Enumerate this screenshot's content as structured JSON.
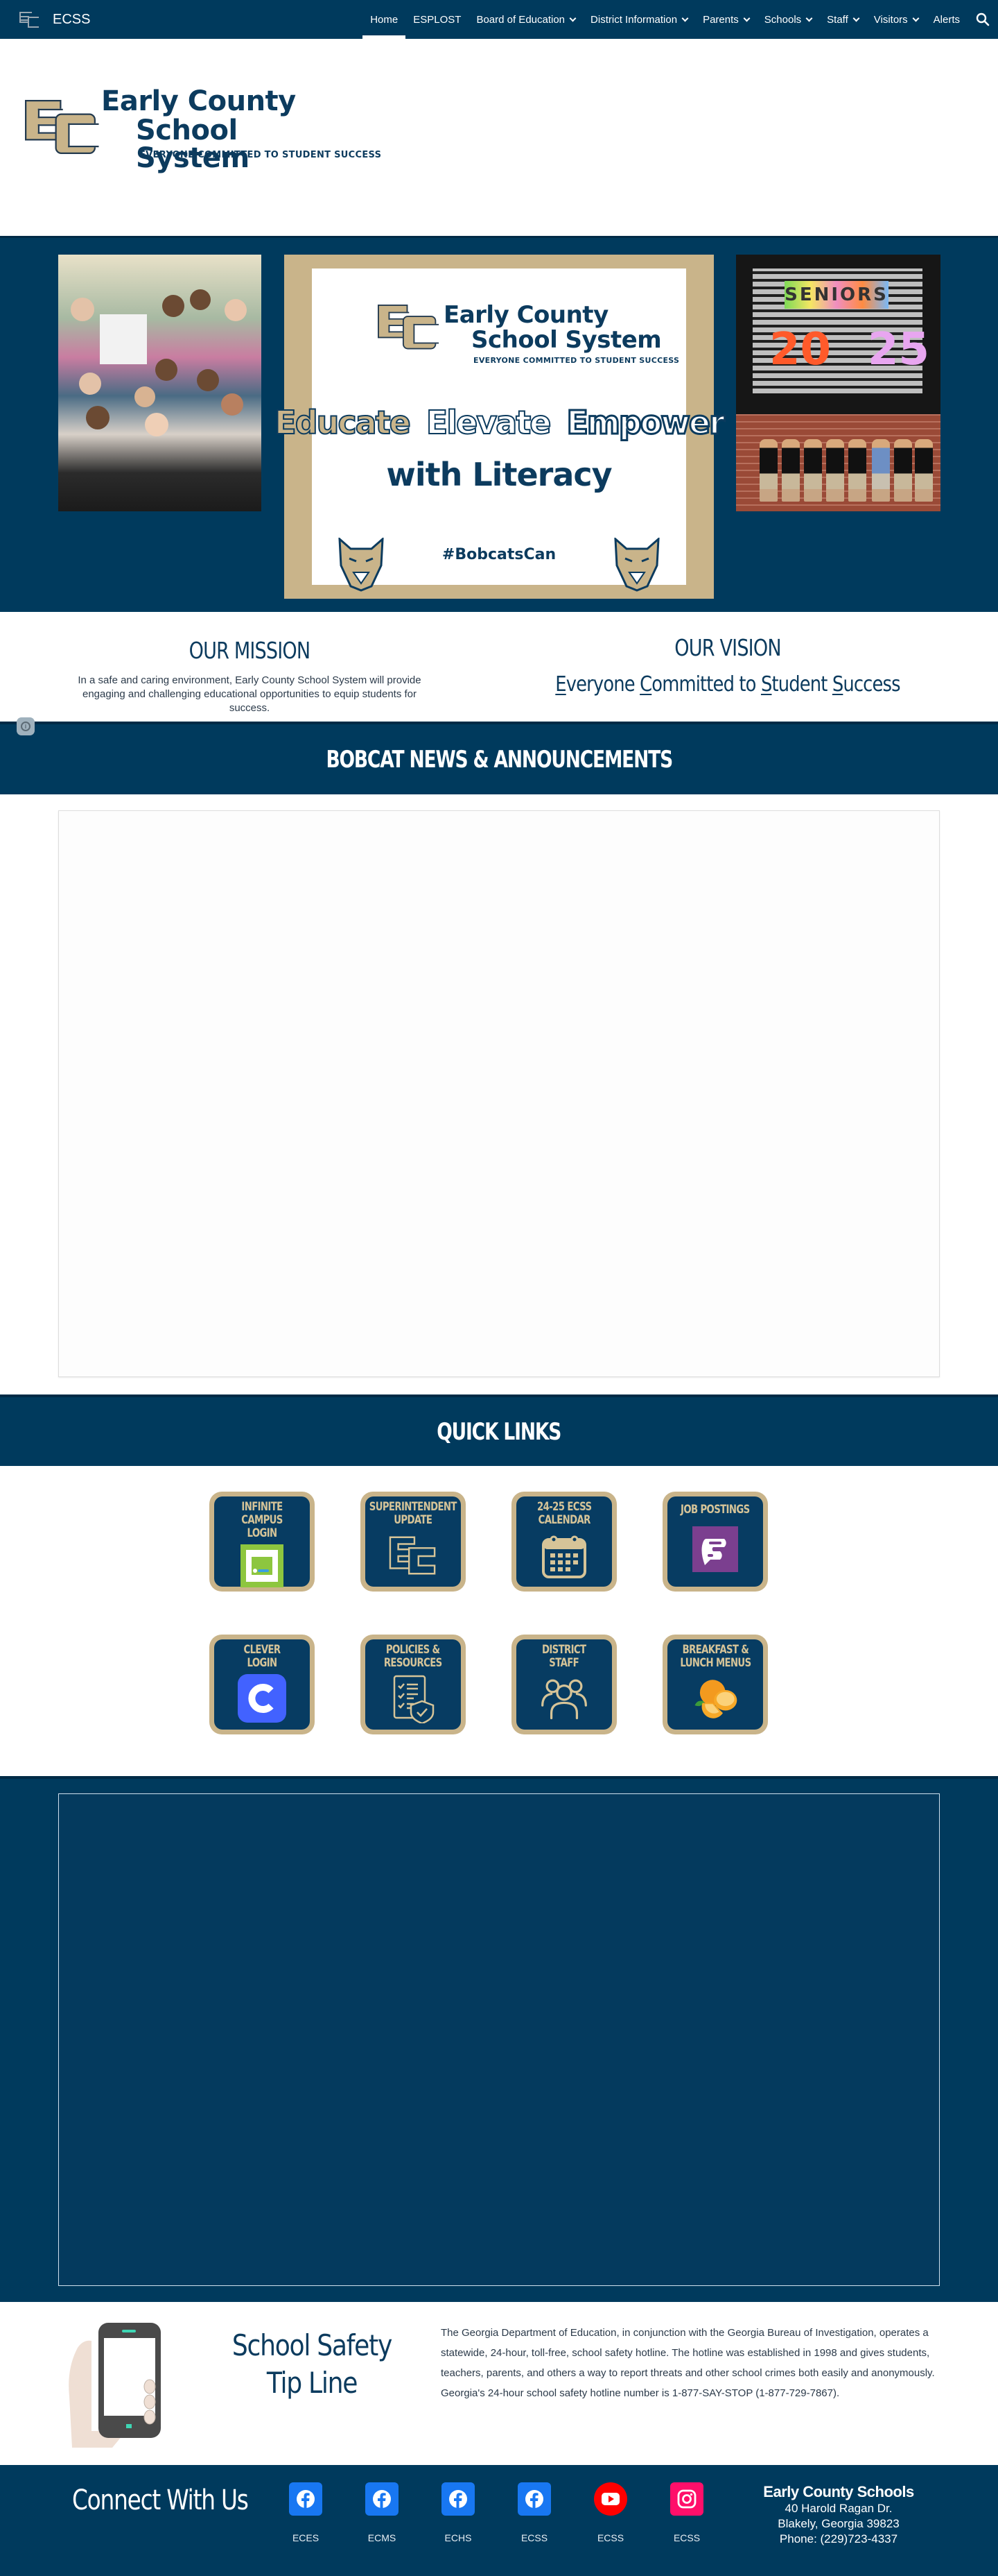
{
  "site": {
    "name": "ECSS",
    "nav": [
      {
        "label": "Home",
        "active": true,
        "dropdown": false
      },
      {
        "label": "ESPLOST",
        "active": false,
        "dropdown": false
      },
      {
        "label": "Board of Education",
        "active": false,
        "dropdown": true
      },
      {
        "label": "District Information",
        "active": false,
        "dropdown": true
      },
      {
        "label": "Parents",
        "active": false,
        "dropdown": true
      },
      {
        "label": "Schools",
        "active": false,
        "dropdown": true
      },
      {
        "label": "Staff",
        "active": false,
        "dropdown": true
      },
      {
        "label": "Visitors",
        "active": false,
        "dropdown": true
      },
      {
        "label": "Alerts",
        "active": false,
        "dropdown": false
      }
    ],
    "search_icon": "search-icon"
  },
  "logo": {
    "line1": "Early County",
    "line2": "School System",
    "tagline": "EVERYONE COMMITTED TO STUDENT SUCCESS"
  },
  "hero": {
    "left_photo_alt": "Group of elementary students in school hallway",
    "right_photo_alt": "Seniors 2025 mural with students",
    "right_photo": {
      "banner": "SENIORS",
      "year_left": "20",
      "year_right": "25"
    },
    "poster": {
      "logo_line1": "Early County",
      "logo_line2": "School System",
      "logo_tagline": "EVERYONE COMMITTED TO STUDENT SUCCESS",
      "words": [
        "Educate",
        "Elevate",
        "Empower"
      ],
      "subline": "with Literacy",
      "hashtag": "#BobcatsCan"
    }
  },
  "mission": {
    "title": "OUR MISSION",
    "text": "In a safe and caring environment, Early County School System will provide engaging and challenging educational opportunities to equip students for success."
  },
  "vision": {
    "title": "OUR VISION",
    "parts": [
      {
        "initial": "E",
        "rest": "veryone "
      },
      {
        "initial": "C",
        "rest": "ommitted to "
      },
      {
        "initial": "S",
        "rest": "tudent "
      },
      {
        "initial": "S",
        "rest": "uccess"
      }
    ]
  },
  "news": {
    "title": "BOBCAT NEWS & ANNOUNCEMENTS"
  },
  "quick_links": {
    "title": "QUICK LINKS",
    "items": [
      {
        "label": "INFINITE CAMPUS\nLOGIN",
        "icon": "infinite-campus-icon"
      },
      {
        "label": "SUPERINTENDENT\nUPDATE",
        "icon": "ec-logo-icon"
      },
      {
        "label": "24-25 ECSS\nCALENDAR",
        "icon": "calendar-icon"
      },
      {
        "label": "JOB POSTINGS",
        "icon": "frontline-icon"
      },
      {
        "label": "CLEVER\nLOGIN",
        "icon": "clever-icon"
      },
      {
        "label": "POLICIES &\nRESOURCES",
        "icon": "checklist-shield-icon"
      },
      {
        "label": "DISTRICT\nSTAFF",
        "icon": "people-icon"
      },
      {
        "label": "BREAKFAST &\nLUNCH MENUS",
        "icon": "orange-icon"
      }
    ]
  },
  "tip_line": {
    "title_line1": "School Safety",
    "title_line2": "Tip Line",
    "text": "The Georgia Department of Education, in conjunction with the Georgia Bureau of Investigation, operates a statewide, 24-hour, toll-free, school safety hotline. The hotline was established in 1998 and gives students, teachers, parents, and others a way to report threats and other school crimes both easily and anonymously. Georgia's 24-hour school safety hotline number is 1-877-SAY-STOP (1-877-729-7867)."
  },
  "footer": {
    "connect_title": "Connect With Us",
    "socials": [
      {
        "network": "facebook",
        "label": "ECES",
        "color": "#1877f2"
      },
      {
        "network": "facebook",
        "label": "ECMS",
        "color": "#1877f2"
      },
      {
        "network": "facebook",
        "label": "ECHS",
        "color": "#1877f2"
      },
      {
        "network": "facebook",
        "label": "ECSS",
        "color": "#1877f2"
      },
      {
        "network": "youtube",
        "label": "ECSS",
        "color": "#ff0000"
      },
      {
        "network": "instagram",
        "label": "ECSS",
        "color": "#ff0f6a"
      }
    ],
    "org_name": "Early County Schools",
    "address_line1": "40 Harold Ragan Dr.",
    "address_line2": "Blakely, Georgia 39823",
    "phone": "Phone: (229)723-4337"
  },
  "colors": {
    "primary": "#003a5d",
    "gold": "#c9b48a",
    "text_dark": "#0c3b5e"
  }
}
